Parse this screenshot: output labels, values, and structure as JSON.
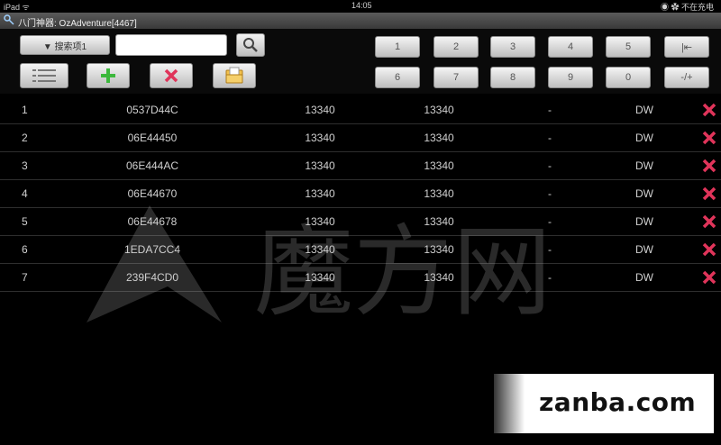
{
  "statusbar": {
    "device": "iPad",
    "wifi": "ᯤ",
    "time": "14:05",
    "right": "◉ ✿ 不在充电"
  },
  "titlebar": {
    "title": "八门神器: OzAdventure[4467]"
  },
  "toolbar": {
    "search_type_label": "▼ 搜索项1",
    "search_value": "",
    "keypad": [
      [
        "1",
        "2",
        "3",
        "4",
        "5",
        "|⇤"
      ],
      [
        "6",
        "7",
        "8",
        "9",
        "0",
        "-/+"
      ]
    ]
  },
  "rows": [
    {
      "index": "1",
      "address": "0537D44C",
      "value": "13340",
      "value2": "13340",
      "dash": "-",
      "type": "DW"
    },
    {
      "index": "2",
      "address": "06E44450",
      "value": "13340",
      "value2": "13340",
      "dash": "-",
      "type": "DW"
    },
    {
      "index": "3",
      "address": "06E444AC",
      "value": "13340",
      "value2": "13340",
      "dash": "-",
      "type": "DW"
    },
    {
      "index": "4",
      "address": "06E44670",
      "value": "13340",
      "value2": "13340",
      "dash": "-",
      "type": "DW"
    },
    {
      "index": "5",
      "address": "06E44678",
      "value": "13340",
      "value2": "13340",
      "dash": "-",
      "type": "DW"
    },
    {
      "index": "6",
      "address": "1EDA7CC4",
      "value": "13340",
      "value2": "13340",
      "dash": "-",
      "type": "DW"
    },
    {
      "index": "7",
      "address": "239F4CD0",
      "value": "13340",
      "value2": "13340",
      "dash": "-",
      "type": "DW"
    }
  ],
  "watermark": {
    "ghost": "魔方网",
    "site": "zanba.com"
  },
  "colors": {
    "accent_green": "#3cb83c",
    "delete_red": "#e0345a",
    "background": "#000000"
  }
}
